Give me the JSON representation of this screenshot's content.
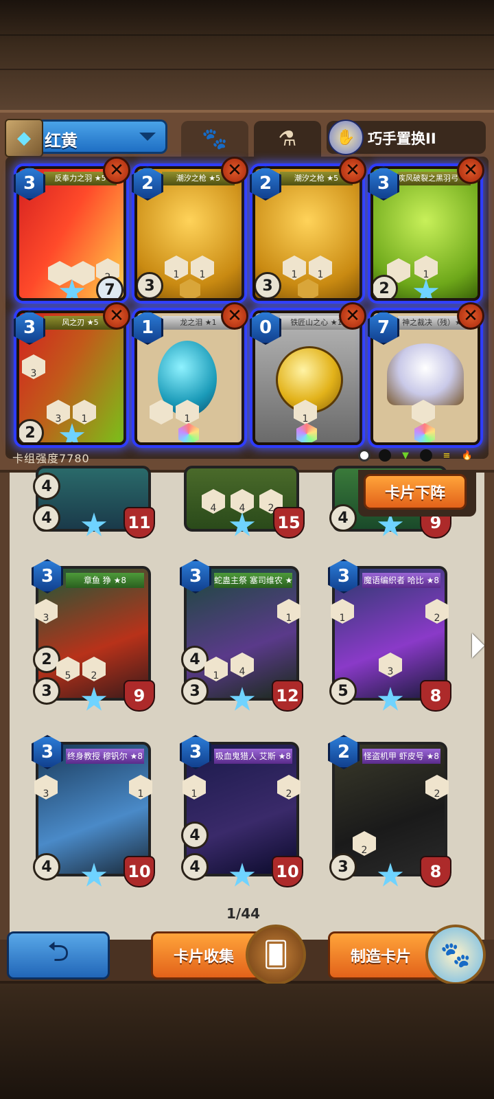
{
  "deck": {
    "name": "红黄",
    "skill_name": "巧手置换II",
    "power_label": "卡组强度7780",
    "tab_beast_icon": "paw-icon",
    "tab_potion_icon": "potion-icon",
    "cards": [
      {
        "cost": "3",
        "title": "反奉力之羽 ★5",
        "badge_left": "",
        "attack": "",
        "health": "7",
        "stat1": "",
        "stat2": "2"
      },
      {
        "cost": "2",
        "title": "潮汐之枪 ★5",
        "attack": "3",
        "stat1": "1",
        "stat2": "1"
      },
      {
        "cost": "2",
        "title": "潮汐之枪 ★5",
        "attack": "3",
        "stat1": "1",
        "stat2": "1"
      },
      {
        "cost": "3",
        "title": "疾风破裂之黑羽弓 ★5",
        "attack": "2",
        "stat1": "1"
      },
      {
        "cost": "3",
        "title": "风之刃 ★5",
        "attack": "2",
        "stat1": "3",
        "stat2": "1",
        "side": "3"
      },
      {
        "cost": "1",
        "title": "龙之泪 ★1",
        "stat1": "1"
      },
      {
        "cost": "0",
        "title": "铁匠山之心 ★1",
        "stat1": "1"
      },
      {
        "cost": "7",
        "title": "神之裁决（残）★1"
      }
    ]
  },
  "collection": {
    "unload_button": "卡片下阵",
    "page": "1/44",
    "top_row": [
      {
        "attack": "4",
        "sub": "4",
        "health": "11"
      },
      {
        "stat1": "4",
        "stat2": "4",
        "stat3": "2",
        "health": "15"
      },
      {
        "attack": "4",
        "health": "9"
      }
    ],
    "cards": [
      {
        "cost": "3",
        "title": "章鱼 狰 ★8",
        "side": "3",
        "dice": "2",
        "attack": "3",
        "stat1": "5",
        "stat2": "2",
        "health": "9"
      },
      {
        "cost": "3",
        "title": "蛇蛊主祭 塞司维农 ★8",
        "side": "1",
        "dice": "4",
        "attack": "3",
        "stat1": "1",
        "stat2": "4",
        "health": "12"
      },
      {
        "cost": "3",
        "title": "魔语编织者 哈比 ★8",
        "side": "1",
        "side2": "2",
        "attack": "5",
        "stat2": "3",
        "health": "8"
      },
      {
        "cost": "3",
        "title": "终身教授 穆钒尔 ★8",
        "side": "3",
        "side2": "1",
        "attack": "4",
        "health": "10"
      },
      {
        "cost": "3",
        "title": "吸血鬼猎人 艾斯 ★8",
        "side": "1",
        "side2": "2",
        "dice": "4",
        "attack": "4",
        "health": "10"
      },
      {
        "cost": "2",
        "title": "怪盗机甲 虾皮号 ★8",
        "side2": "2",
        "attack": "3",
        "stat1": "2",
        "health": "8"
      }
    ]
  },
  "bottom": {
    "collect_button": "卡片收集",
    "craft_button": "制造卡片",
    "back_icon": "back-arrow-icon"
  },
  "colors": {
    "accent_blue": "#2b7bd6",
    "accent_orange": "#f08a2a",
    "glow": "#2e3cff"
  }
}
